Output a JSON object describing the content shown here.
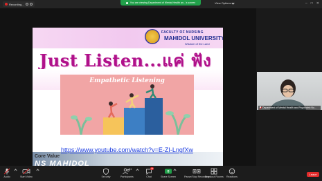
{
  "topbar": {
    "recording_label": "Recording...",
    "share_banner": "You are viewing Department of Mental Health an...'s screen",
    "view_options": "View Options",
    "window_controls": [
      "–",
      "□",
      "✕"
    ]
  },
  "slide": {
    "title": "Just Listen...แค่ ฟัง",
    "logo_line1": "FACULTY OF NURSING",
    "logo_line2": "MAHIDOL UNIVERSITY",
    "logo_line3": "Wisdom of the Land",
    "illustration_title": "Empathetic Listening",
    "link": "https://www.youtube.com/watch?v=E-ZI-LngfXw",
    "core_value": "Core Value",
    "brand": "NS MAHIDOL"
  },
  "participant": {
    "name": "Department of Mental Health and Psychiatric Nu..."
  },
  "toolbar": {
    "items": [
      {
        "label": "Audio",
        "icon": "mic-icon"
      },
      {
        "label": "Start Video",
        "icon": "video-off-icon"
      },
      {
        "label": "Security",
        "icon": "shield-icon"
      },
      {
        "label": "Participants",
        "icon": "participants-icon",
        "count": "81"
      },
      {
        "label": "Chat",
        "icon": "chat-icon",
        "badge": "23"
      },
      {
        "label": "Share Screen",
        "icon": "share-screen-icon"
      },
      {
        "label": "Pause/Stop Recording",
        "icon": "record-icon"
      },
      {
        "label": "Breakout Rooms",
        "icon": "breakout-icon"
      },
      {
        "label": "Reactions",
        "icon": "reaction-icon"
      }
    ],
    "leave": "Leave"
  },
  "colors": {
    "share_green": "#21a04a",
    "leave_red": "#e22c2c",
    "title_magenta": "#b0118a",
    "link_blue": "#1a3be0",
    "illustration_pink": "#f1a5a5"
  }
}
